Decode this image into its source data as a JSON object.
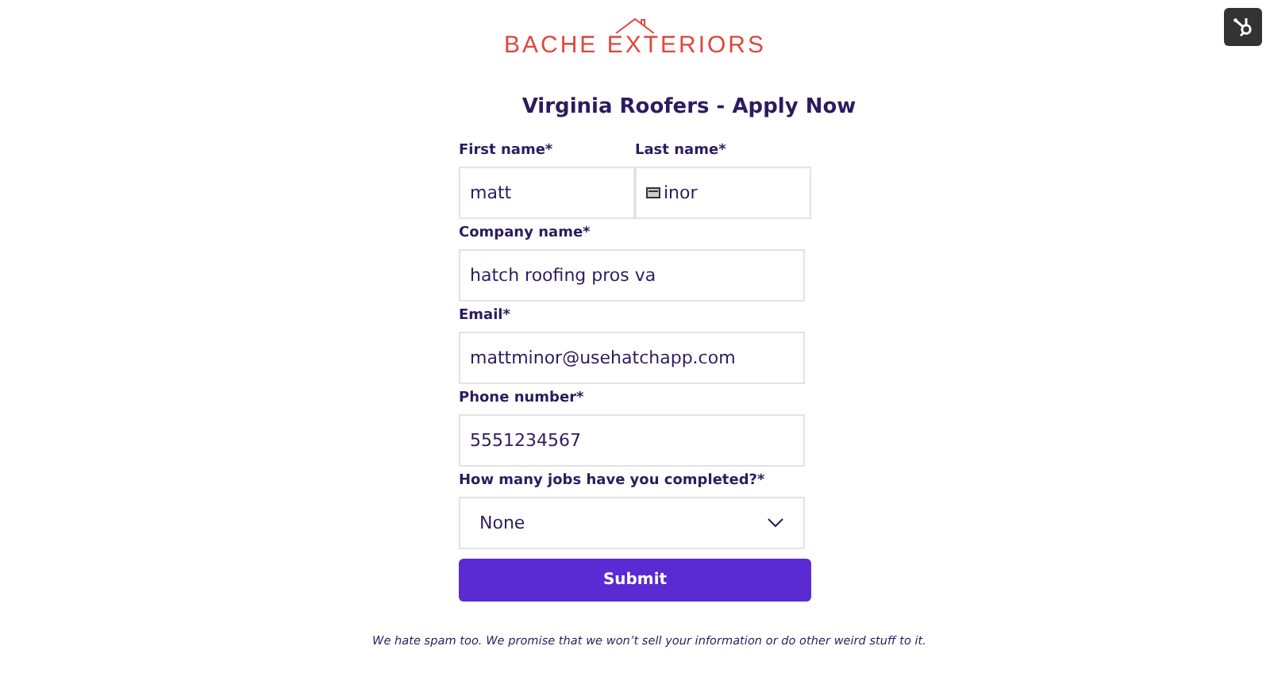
{
  "logo": {
    "text": "BACHE EXTERIORS"
  },
  "form": {
    "title": "Virginia Roofers - Apply Now",
    "name_row": [
      {
        "label": "First name*",
        "value": "matt",
        "kind": "text"
      },
      {
        "label": "Last name*",
        "value": "inor",
        "kind": "autofill"
      }
    ],
    "fields": [
      {
        "label": "Company name*",
        "value": "hatch roofing pros va",
        "kind": "text"
      },
      {
        "label": "Email*",
        "value": "mattminor@usehatchapp.com",
        "kind": "text"
      },
      {
        "label": "Phone number*",
        "value": "5551234567",
        "kind": "text"
      },
      {
        "label": "How many jobs have you completed?*",
        "value": "None",
        "kind": "select"
      }
    ],
    "submit": "Submit",
    "footnote": "We hate spam too. We promise that we won’t sell your information or do other weird stuff to it."
  }
}
